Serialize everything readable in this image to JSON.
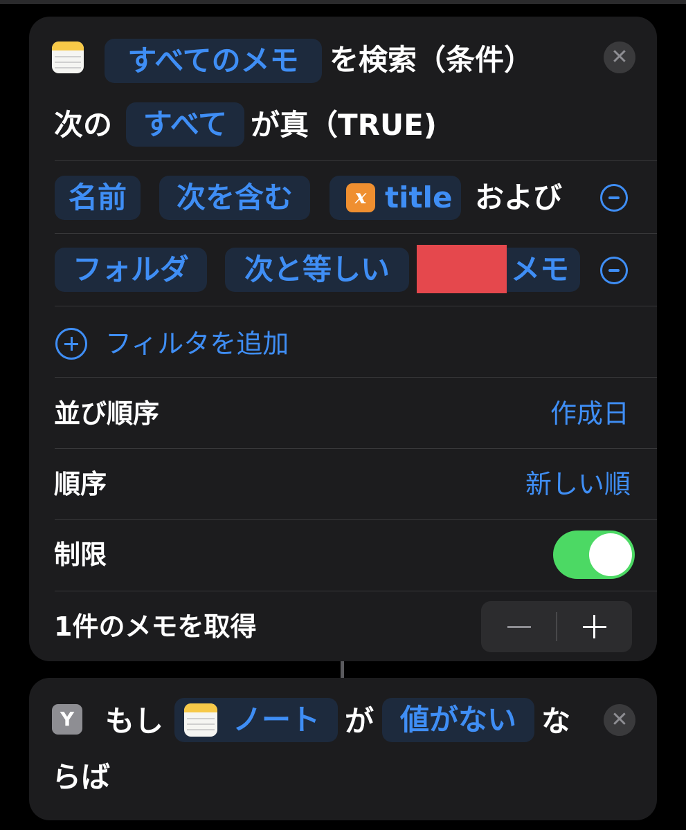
{
  "find_notes_action": {
    "action_prefix_pill": "すべてのメモ",
    "action_suffix": "を検索（条件）",
    "condition_prefix": "次の",
    "condition_pill": "すべて",
    "condition_suffix": "が真（TRUE)",
    "filter1": {
      "field": "名前",
      "operator": "次を含む",
      "variable": "title",
      "conjunction": "および"
    },
    "filter2": {
      "field": "フォルダ",
      "operator": "次と等しい",
      "value_visible_part": "メモ"
    },
    "add_filter_label": "フィルタを追加",
    "sort_by": {
      "label": "並び順序",
      "value": "作成日"
    },
    "order": {
      "label": "順序",
      "value": "新しい順"
    },
    "limit": {
      "label": "制限",
      "enabled": true
    },
    "get_count_label": "1件のメモを取得"
  },
  "if_action": {
    "prefix": "もし",
    "variable_pill": "ノート",
    "middle": "が",
    "condition_pill": "値がない",
    "suffix_line1": "な",
    "suffix_line2": "らば"
  },
  "colors": {
    "background": "#000000",
    "card": "#1c1c1e",
    "accent_blue": "#3f8ef5",
    "pill_bg": "#1d2a3d",
    "toggle_on": "#4cd964",
    "variable_orange": "#ef8f30",
    "redaction": "#e5484d"
  },
  "icons": [
    "notes-app-icon",
    "close-icon",
    "variable-x-icon",
    "remove-circle-icon",
    "add-circle-icon",
    "if-branch-icon"
  ]
}
